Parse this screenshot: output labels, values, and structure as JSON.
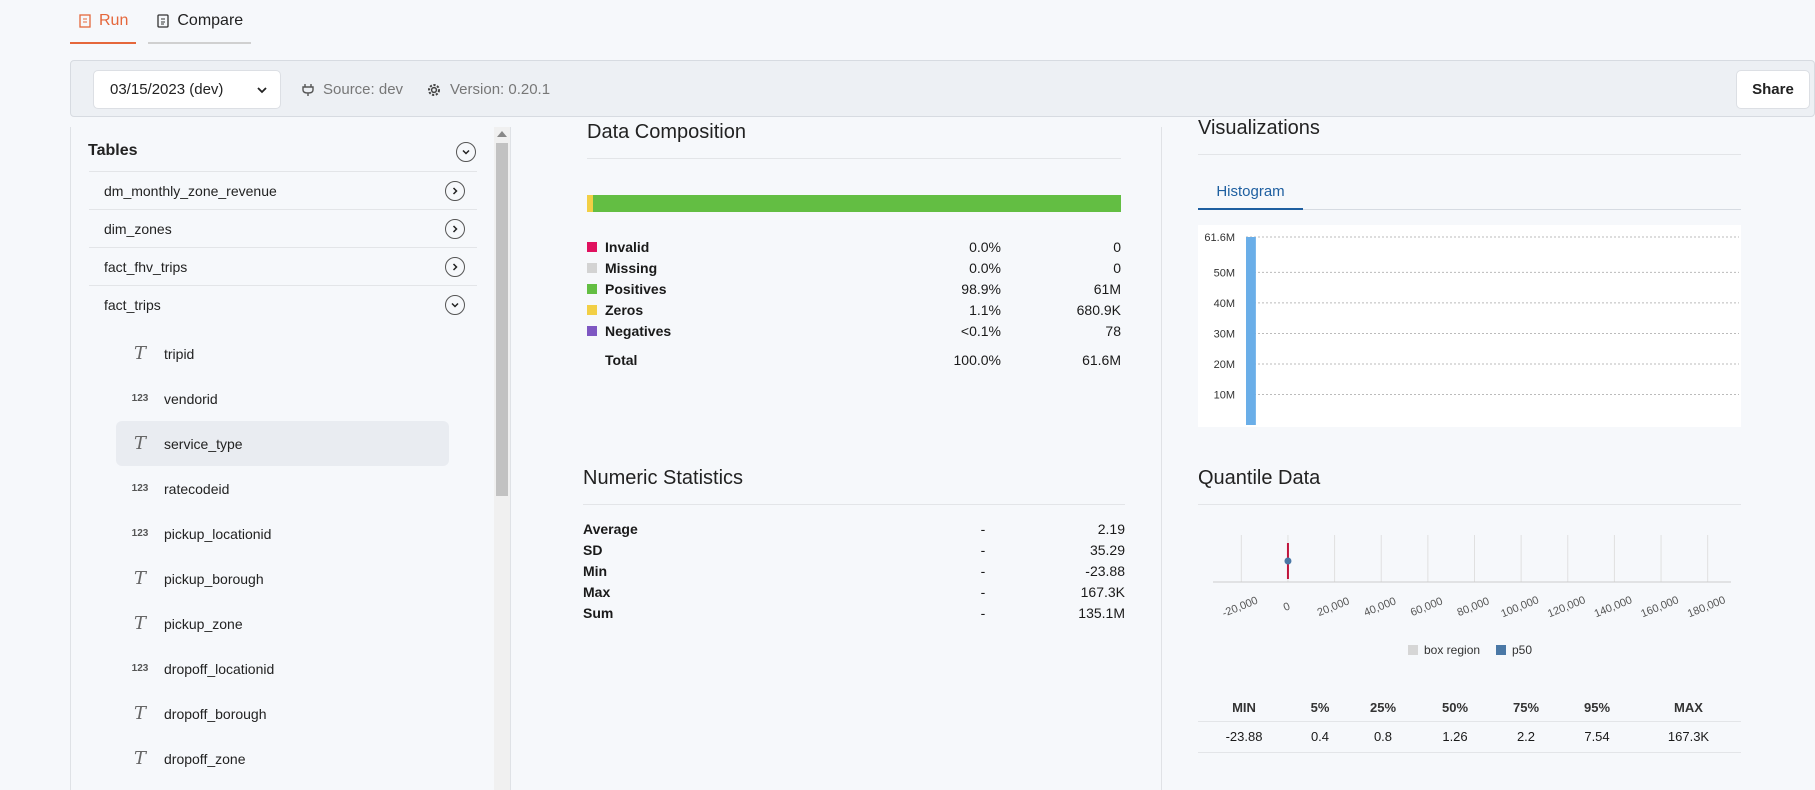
{
  "tabs": [
    {
      "label": "Run",
      "icon": "run-report-icon",
      "active": true
    },
    {
      "label": "Compare",
      "icon": "compare-doc-icon",
      "active": false
    }
  ],
  "toolbar": {
    "date_value": "03/15/2023 (dev)",
    "source": "Source: dev",
    "version": "Version: 0.20.1",
    "share_label": "Share"
  },
  "sidebar": {
    "title": "Tables",
    "tables": [
      "dm_monthly_zone_revenue",
      "dim_zones",
      "fact_fhv_trips",
      "fact_trips"
    ],
    "expanded_table": "fact_trips",
    "columns": [
      {
        "name": "tripid",
        "type": "text"
      },
      {
        "name": "vendorid",
        "type": "number"
      },
      {
        "name": "service_type",
        "type": "text",
        "selected": true
      },
      {
        "name": "ratecodeid",
        "type": "number"
      },
      {
        "name": "pickup_locationid",
        "type": "number"
      },
      {
        "name": "pickup_borough",
        "type": "text"
      },
      {
        "name": "pickup_zone",
        "type": "text"
      },
      {
        "name": "dropoff_locationid",
        "type": "number"
      },
      {
        "name": "dropoff_borough",
        "type": "text"
      },
      {
        "name": "dropoff_zone",
        "type": "text"
      }
    ],
    "type_glyphs": {
      "text": "T",
      "number": "123"
    }
  },
  "composition": {
    "title": "Data Composition",
    "rows": [
      {
        "name": "Invalid",
        "pct": "0.0%",
        "count": "0",
        "color": "#e0115f",
        "fraction": 0.0
      },
      {
        "name": "Missing",
        "pct": "0.0%",
        "count": "0",
        "color": "#d3d3d3",
        "fraction": 0.0
      },
      {
        "name": "Positives",
        "pct": "98.9%",
        "count": "61M",
        "color": "#63be43",
        "fraction": 0.989
      },
      {
        "name": "Zeros",
        "pct": "1.1%",
        "count": "680.9K",
        "color": "#f2cf45",
        "fraction": 0.011
      },
      {
        "name": "Negatives",
        "pct": "<0.1%",
        "count": "78",
        "color": "#7e57c2",
        "fraction": 0.0
      }
    ],
    "total": {
      "name": "Total",
      "pct": "100.0%",
      "count": "61.6M"
    }
  },
  "numeric_stats": {
    "title": "Numeric Statistics",
    "rows": [
      {
        "name": "Average",
        "dash": "-",
        "value": "2.19"
      },
      {
        "name": "SD",
        "dash": "-",
        "value": "35.29"
      },
      {
        "name": "Min",
        "dash": "-",
        "value": "-23.88"
      },
      {
        "name": "Max",
        "dash": "-",
        "value": "167.3K"
      },
      {
        "name": "Sum",
        "dash": "-",
        "value": "135.1M"
      }
    ]
  },
  "visualizations": {
    "title": "Visualizations",
    "tab_label": "Histogram"
  },
  "quantile": {
    "title": "Quantile Data",
    "headers": [
      "MIN",
      "5%",
      "25%",
      "50%",
      "75%",
      "95%",
      "MAX"
    ],
    "values": [
      "-23.88",
      "0.4",
      "0.8",
      "1.26",
      "2.2",
      "7.54",
      "167.3K"
    ]
  },
  "chart_data": [
    {
      "type": "bar",
      "title": "",
      "yticks": [
        "61.6M",
        "50M",
        "40M",
        "30M",
        "20M",
        "10M"
      ],
      "ytick_values": [
        61600000,
        50000000,
        40000000,
        30000000,
        20000000,
        10000000
      ],
      "ylim": [
        0,
        61600000
      ],
      "bins": 50,
      "values": [
        61600000,
        0,
        0,
        0,
        0,
        0,
        0,
        0,
        0,
        0,
        0,
        0,
        0,
        0,
        0,
        0,
        0,
        0,
        0,
        0,
        0,
        0,
        0,
        0,
        0,
        0,
        0,
        0,
        0,
        0,
        0,
        0,
        0,
        0,
        0,
        0,
        0,
        0,
        0,
        0,
        0,
        0,
        0,
        0,
        0,
        0,
        0,
        0,
        0,
        0
      ],
      "bar_color": "#6aaee8",
      "grid": true
    },
    {
      "type": "scatter",
      "title": "",
      "xticks": [
        "-20,000",
        "0",
        "20,000",
        "40,000",
        "60,000",
        "80,000",
        "100,000",
        "120,000",
        "140,000",
        "160,000",
        "180,000"
      ],
      "xtick_values": [
        -20000,
        0,
        20000,
        40000,
        60000,
        80000,
        100000,
        120000,
        140000,
        160000,
        180000
      ],
      "xlim": [
        -30000,
        190000
      ],
      "box_region": [
        0.8,
        2.2
      ],
      "whiskers": [
        -23.88,
        167300
      ],
      "p50": 1.26,
      "legend": [
        {
          "name": "box region",
          "color": "#d6d6d6"
        },
        {
          "name": "p50",
          "color": "#4a78a6"
        }
      ],
      "whisker_color": "#c0143c",
      "grid": true
    }
  ]
}
